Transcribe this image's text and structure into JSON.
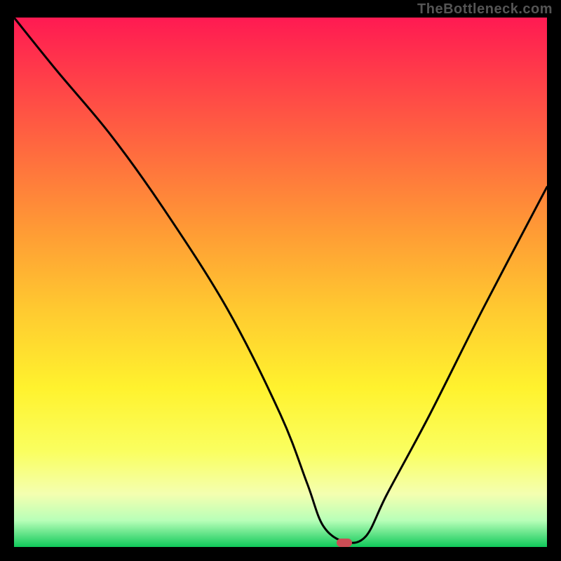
{
  "watermark": "TheBottleneck.com",
  "chart_data": {
    "type": "line",
    "title": "",
    "xlabel": "",
    "ylabel": "",
    "xlim": [
      0,
      100
    ],
    "ylim": [
      0,
      100
    ],
    "series": [
      {
        "name": "bottleneck-curve",
        "x": [
          0,
          8,
          18,
          28,
          40,
          50,
          55,
          58,
          62,
          66,
          70,
          78,
          88,
          100
        ],
        "values": [
          100,
          90,
          78,
          64,
          45,
          25,
          12,
          4,
          1,
          2,
          10,
          25,
          45,
          68
        ]
      }
    ],
    "marker": {
      "x": 62,
      "y": 0.8
    },
    "gradient_stops": [
      {
        "pos": 0,
        "color": "#ff1a52"
      },
      {
        "pos": 10,
        "color": "#ff3a4a"
      },
      {
        "pos": 25,
        "color": "#ff6a3f"
      },
      {
        "pos": 40,
        "color": "#ff9a35"
      },
      {
        "pos": 55,
        "color": "#ffc930"
      },
      {
        "pos": 70,
        "color": "#fff22e"
      },
      {
        "pos": 82,
        "color": "#faff60"
      },
      {
        "pos": 90,
        "color": "#f4ffb0"
      },
      {
        "pos": 95,
        "color": "#b8ffb8"
      },
      {
        "pos": 100,
        "color": "#10c95a"
      }
    ]
  }
}
